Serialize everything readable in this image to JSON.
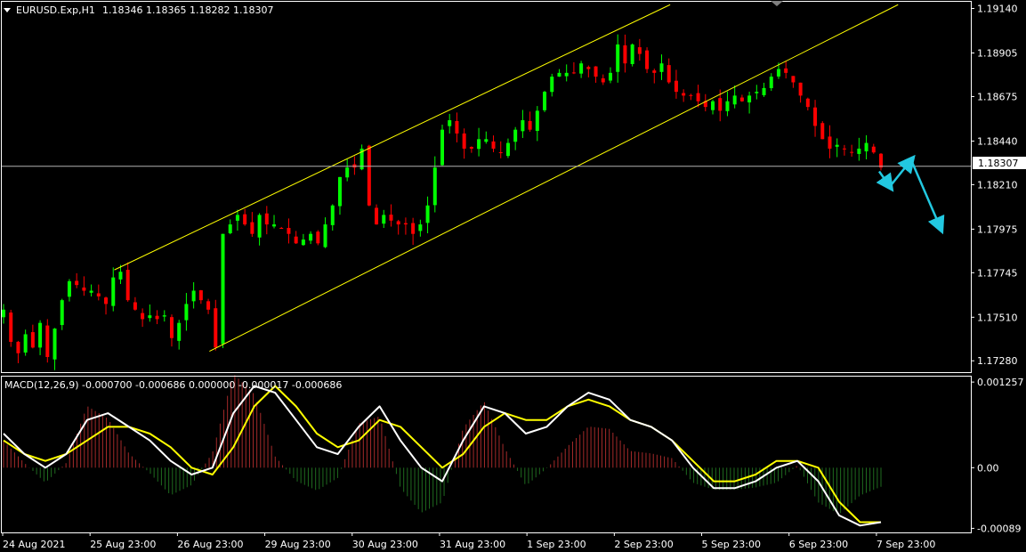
{
  "header": {
    "symbol_label": "EURUSD.Exp,H1",
    "ohlc": "1.18346 1.18365 1.18282 1.18307"
  },
  "macd_header": "MACD(12,26,9) -0.000700 -0.000686 0.000000 -0.000017 -0.000686",
  "current_price_label": "1.18307",
  "colors": {
    "background": "#000000",
    "grid_frame": "#ffffff",
    "bull": "#00ff00",
    "bear": "#ff0000",
    "channel": "#ffff00",
    "arrow": "#22c8e0",
    "macd_line": "#ffffff",
    "signal_line": "#ffff00",
    "hist_pos": "#a52a2a",
    "hist_neg": "#1f6b1f"
  },
  "chart_data": [
    {
      "type": "candlestick",
      "title": "EURUSD.Exp,H1",
      "ylim": [
        1.1722,
        1.1918
      ],
      "y_ticks": [
        "1.19140",
        "1.18905",
        "1.18675",
        "1.18440",
        "1.18210",
        "1.17975",
        "1.17745",
        "1.17510",
        "1.17280"
      ],
      "x_ticks": [
        "24 Aug 2021",
        "25 Aug 23:00",
        "26 Aug 23:00",
        "29 Aug 23:00",
        "30 Aug 23:00",
        "31 Aug 23:00",
        "1 Sep 23:00",
        "2 Sep 23:00",
        "5 Sep 23:00",
        "6 Sep 23:00",
        "7 Sep 23:00"
      ],
      "close_path": [
        1.1755,
        1.1738,
        1.1732,
        1.1742,
        1.1735,
        1.1748,
        1.173,
        1.1745,
        1.176,
        1.177,
        1.1768,
        1.1765,
        1.1765,
        1.1762,
        1.1758,
        1.1772,
        1.1775,
        1.176,
        1.1755,
        1.175,
        1.1752,
        1.175,
        1.1752,
        1.174,
        1.1748,
        1.1758,
        1.1765,
        1.176,
        1.1755,
        1.1735,
        1.1795,
        1.18,
        1.1805,
        1.18,
        1.1795,
        1.1805,
        1.18,
        1.18,
        1.1798,
        1.1795,
        1.179,
        1.1792,
        1.1795,
        1.179,
        1.18,
        1.181,
        1.1825,
        1.183,
        1.183,
        1.184,
        1.181,
        1.18,
        1.1805,
        1.1802,
        1.18,
        1.18,
        1.1795,
        1.18,
        1.181,
        1.183,
        1.185,
        1.1855,
        1.1848,
        1.184,
        1.184,
        1.1845,
        1.1845,
        1.184,
        1.1838,
        1.1843,
        1.185,
        1.1855,
        1.185,
        1.186,
        1.187,
        1.1878,
        1.188,
        1.188,
        1.188,
        1.1885,
        1.1882,
        1.1878,
        1.1875,
        1.188,
        1.1895,
        1.1885,
        1.1895,
        1.189,
        1.1882,
        1.188,
        1.1885,
        1.1875,
        1.187,
        1.1868,
        1.1868,
        1.1865,
        1.1862,
        1.1865,
        1.186,
        1.1865,
        1.1868,
        1.1865,
        1.1868,
        1.187,
        1.1872,
        1.1878,
        1.1882,
        1.188,
        1.1875,
        1.1868,
        1.1862,
        1.1852,
        1.1845,
        1.184,
        1.1842,
        1.184,
        1.1838,
        1.184,
        1.1843,
        1.1838,
        1.183
      ],
      "volumes": [],
      "channel_upper": [
        [
          1.1776,
          0.117
        ],
        [
          1.1916,
          0.69
        ]
      ],
      "channel_lower": [
        [
          1.1733,
          0.215
        ],
        [
          1.1916,
          0.925
        ]
      ],
      "forecast_arrows": [
        [
          1.1828,
          1.182,
          1.1834,
          1.1798
        ]
      ]
    },
    {
      "type": "line",
      "title": "MACD(12,26,9) -0.000700 -0.000686 0.000000 -0.000017 -0.000686",
      "ylim": [
        -0.00095,
        0.00135
      ],
      "y_ticks": [
        "0.001257",
        "0.00",
        "-0.00089"
      ],
      "series": [
        {
          "name": "MACD",
          "values": [
            0.0005,
            0.0002,
            0.0,
            0.0002,
            0.0007,
            0.0008,
            0.0006,
            0.0004,
            0.0001,
            -0.0001,
            0.0,
            0.0008,
            0.0012,
            0.0011,
            0.0007,
            0.0003,
            0.0002,
            0.0006,
            0.0009,
            0.0004,
            0.0,
            -0.0002,
            0.0004,
            0.0009,
            0.0008,
            0.0005,
            0.0006,
            0.0009,
            0.0011,
            0.001,
            0.0007,
            0.0006,
            0.0004,
            0.0,
            -0.0003,
            -0.0003,
            -0.0002,
            0.0,
            0.0001,
            -0.0002,
            -0.0007,
            -0.00085,
            -0.0008
          ]
        },
        {
          "name": "Signal",
          "values": [
            0.0004,
            0.0002,
            0.0001,
            0.0002,
            0.0004,
            0.0006,
            0.0006,
            0.0005,
            0.0003,
            0.0,
            -0.0001,
            0.0003,
            0.0009,
            0.0012,
            0.0009,
            0.0005,
            0.0003,
            0.0004,
            0.0007,
            0.0006,
            0.0003,
            0.0,
            0.0002,
            0.0006,
            0.0008,
            0.0007,
            0.0007,
            0.0009,
            0.001,
            0.0009,
            0.0007,
            0.0006,
            0.0004,
            0.0001,
            -0.0002,
            -0.0002,
            -0.0001,
            0.0001,
            0.0001,
            0.0,
            -0.0005,
            -0.0008,
            -0.0008
          ]
        }
      ]
    }
  ]
}
